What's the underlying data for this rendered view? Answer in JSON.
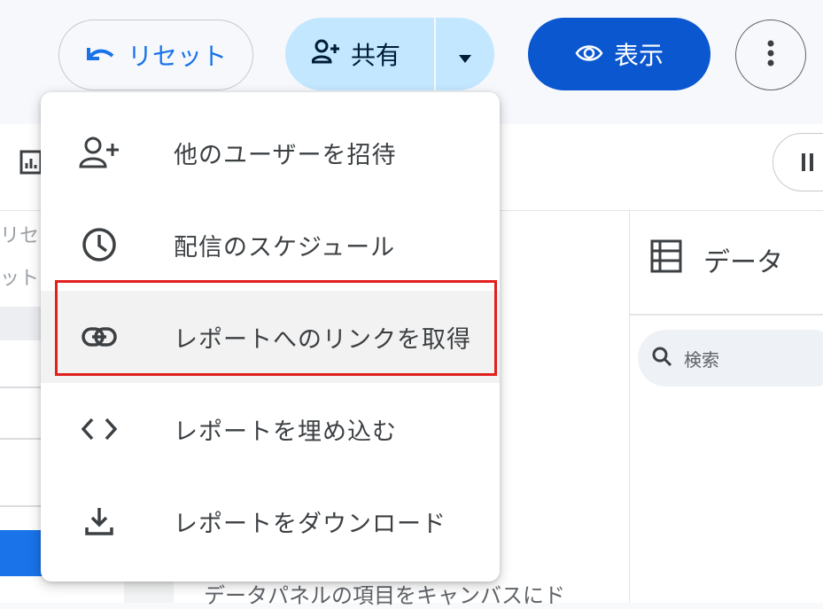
{
  "toolbar": {
    "reset_label": "リセット",
    "share_label": "共有",
    "view_label": "表示"
  },
  "share_menu": {
    "items": [
      {
        "icon": "person-add-icon",
        "label": "他のユーザーを招待"
      },
      {
        "icon": "clock-icon",
        "label": "配信のスケジュール"
      },
      {
        "icon": "link-icon",
        "label": "レポートへのリンクを取得"
      },
      {
        "icon": "code-icon",
        "label": "レポートを埋め込む"
      },
      {
        "icon": "download-icon",
        "label": "レポートをダウンロード"
      }
    ],
    "highlighted_index": 2
  },
  "left_panel": {
    "fragment_1": "リセ",
    "fragment_2": "ット"
  },
  "data_panel": {
    "title": "データ",
    "search_placeholder": "検索"
  },
  "canvas": {
    "hint_text": "データパネルの項目をキャンバスにド"
  },
  "colors": {
    "share_bg": "#c2e7ff",
    "view_bg": "#0b57d0",
    "accent": "#1a73e8",
    "highlight_border": "#e0201e"
  }
}
